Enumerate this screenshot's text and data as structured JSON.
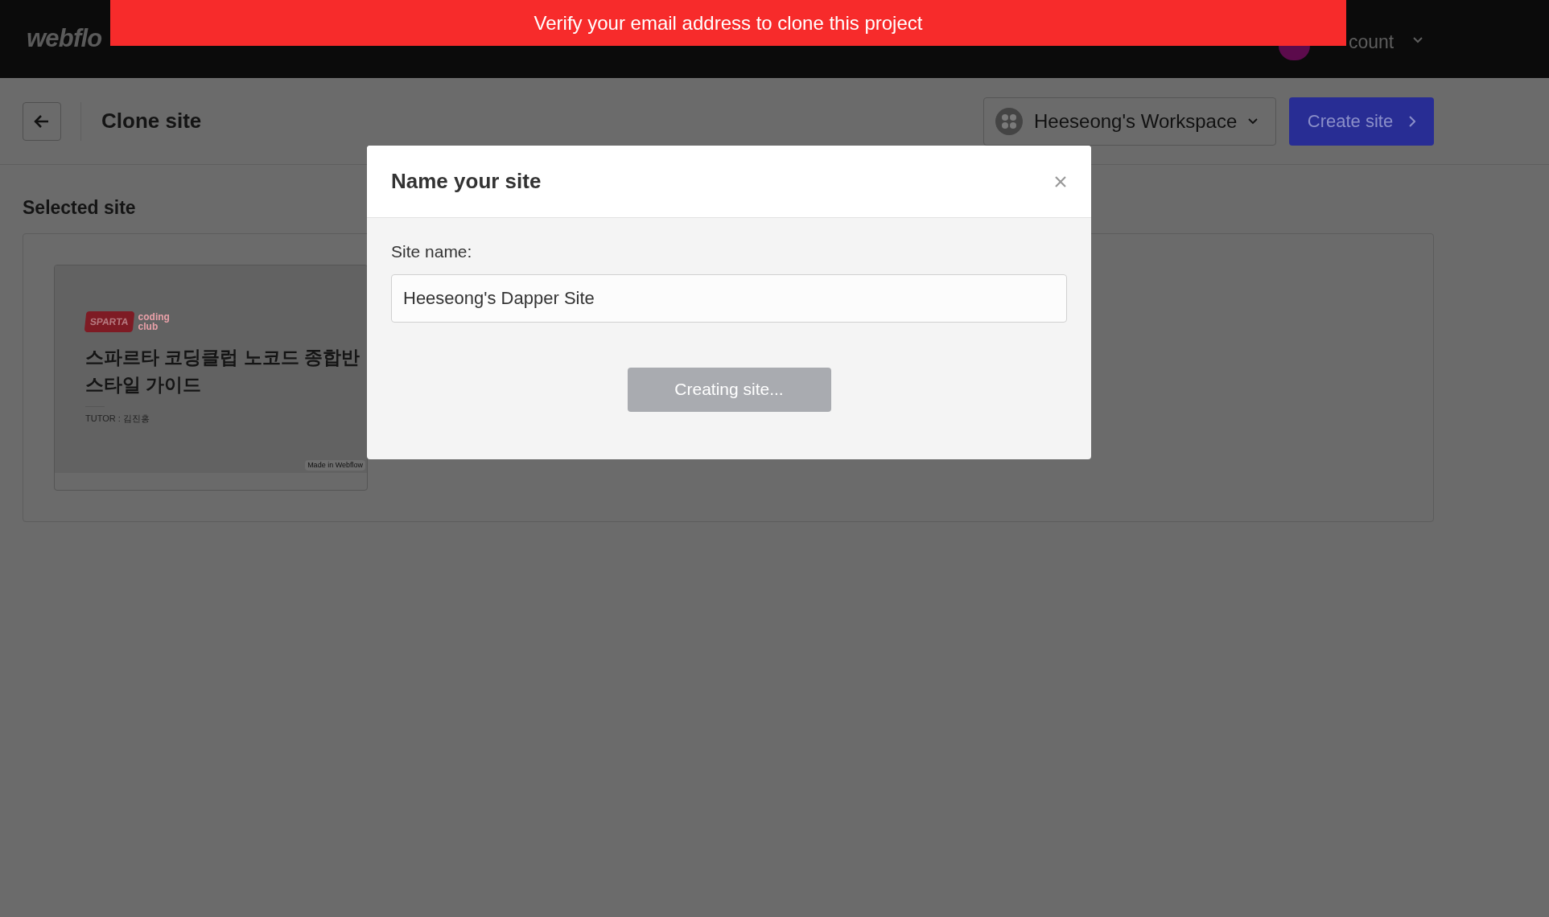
{
  "top_bar": {
    "logo": "webflo",
    "account_label": "count"
  },
  "banner": {
    "text": "Verify your email address to clone this project"
  },
  "header": {
    "title": "Clone site",
    "workspace": {
      "name": "Heeseong's Workspace"
    },
    "create_button": {
      "label": "Create site"
    }
  },
  "selected_site": {
    "heading": "Selected site",
    "thumbnail": {
      "logo_text": "SPARTA",
      "logo_side": [
        "coding",
        "club"
      ],
      "title_lines": [
        "스파르타 코딩클럽 노코드 종합반",
        "스타일 가이드"
      ],
      "tutor": "TUTOR : 김진홍",
      "badge": "Made in Webflow"
    }
  },
  "modal": {
    "title": "Name your site",
    "field_label": "Site name:",
    "field_value": "Heeseong's Dapper Site",
    "button": {
      "label": "Creating site...",
      "disabled": true
    }
  }
}
